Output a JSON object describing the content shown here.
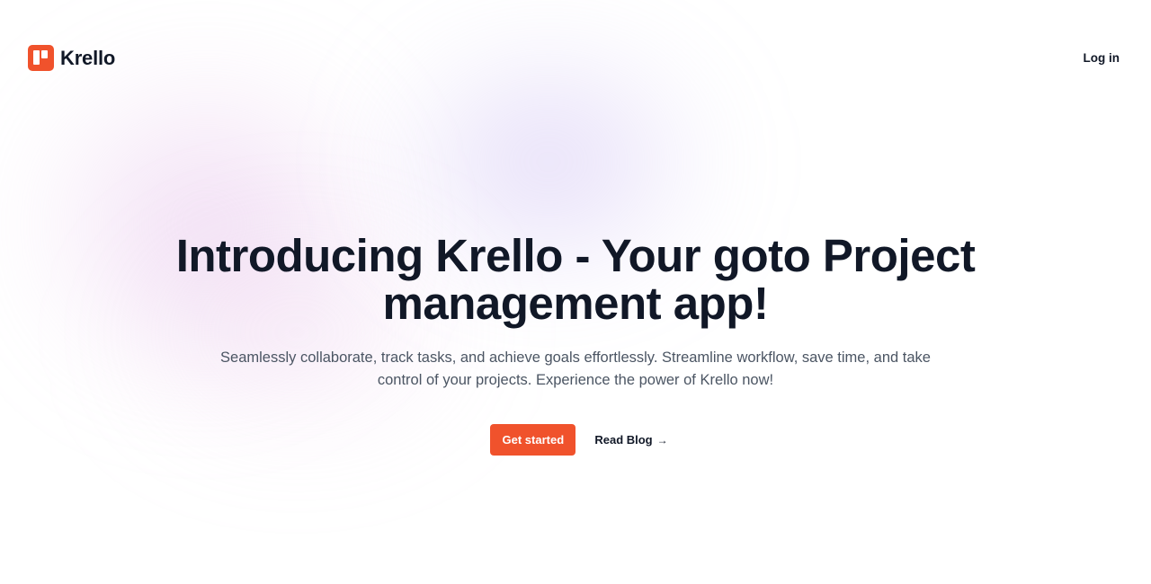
{
  "brand": {
    "name": "Krello",
    "logo_icon": "krello-logo-icon",
    "accent_color": "#f0522c"
  },
  "nav": {
    "login_label": "Log in"
  },
  "hero": {
    "title": "Introducing Krello - Your goto Project management app!",
    "subtitle": "Seamlessly collaborate, track tasks, and achieve goals effortlessly. Streamline workflow, save time, and take control of your projects. Experience the power of Krello now!",
    "primary_cta": "Get started",
    "secondary_cta": "Read Blog",
    "secondary_cta_icon": "arrow-right-icon",
    "secondary_cta_arrow": "→"
  }
}
